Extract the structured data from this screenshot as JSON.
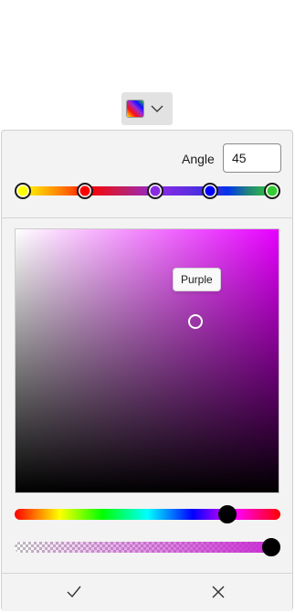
{
  "dropdown": {
    "icon": "gradient-swatch-icon",
    "chevron": "chevron-down-icon"
  },
  "angle": {
    "label": "Angle",
    "value": "45"
  },
  "gradient_stops": [
    {
      "color": "#ffff00",
      "position": 0.0
    },
    {
      "color": "#ff0000",
      "position": 0.25
    },
    {
      "color": "#8a2be2",
      "position": 0.53
    },
    {
      "color": "#0000ff",
      "position": 0.75
    },
    {
      "color": "#33cc33",
      "position": 1.0
    }
  ],
  "color_spectrum": {
    "hue_color": "#e600ff",
    "tooltip": "Purple",
    "saturation": 0.68,
    "value": 0.65
  },
  "hue_slider": {
    "level": 0.8
  },
  "alpha_slider": {
    "level": 1.0
  },
  "footer": {
    "confirm_icon": "checkmark-icon",
    "cancel_icon": "close-icon"
  }
}
